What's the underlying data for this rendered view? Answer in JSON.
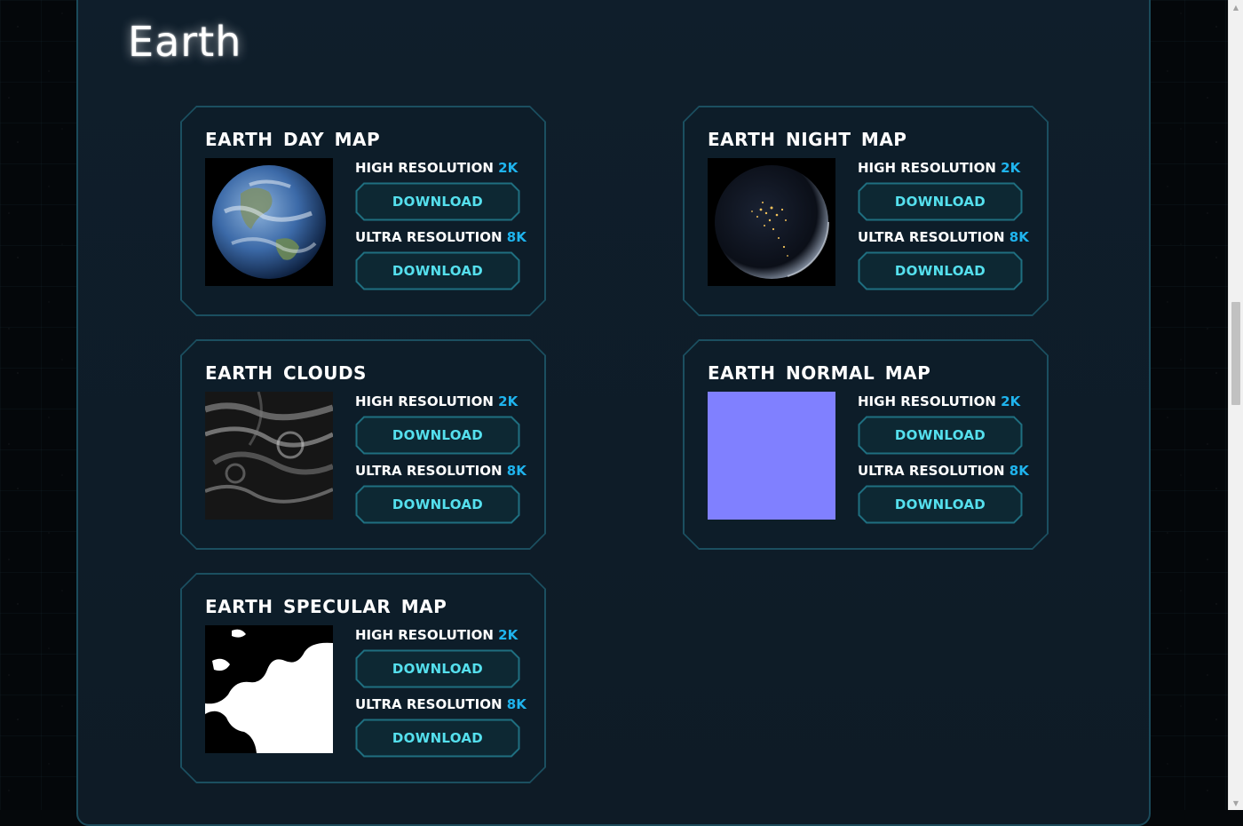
{
  "section": {
    "title": "Earth"
  },
  "cards": [
    {
      "title": "EARTH DAY MAP",
      "thumbnail": "earth-day-globe",
      "high": {
        "label": "HIGH RESOLUTION",
        "value": "2K",
        "button": "DOWNLOAD"
      },
      "ultra": {
        "label": "ULTRA RESOLUTION",
        "value": "8K",
        "button": "DOWNLOAD"
      }
    },
    {
      "title": "EARTH NIGHT MAP",
      "thumbnail": "earth-night-globe",
      "high": {
        "label": "HIGH RESOLUTION",
        "value": "2K",
        "button": "DOWNLOAD"
      },
      "ultra": {
        "label": "ULTRA RESOLUTION",
        "value": "8K",
        "button": "DOWNLOAD"
      }
    },
    {
      "title": "EARTH CLOUDS",
      "thumbnail": "earth-clouds-texture",
      "high": {
        "label": "HIGH RESOLUTION",
        "value": "2K",
        "button": "DOWNLOAD"
      },
      "ultra": {
        "label": "ULTRA RESOLUTION",
        "value": "8K",
        "button": "DOWNLOAD"
      }
    },
    {
      "title": "EARTH NORMAL MAP",
      "thumbnail": "normal-map-swatch",
      "high": {
        "label": "HIGH RESOLUTION",
        "value": "2K",
        "button": "DOWNLOAD"
      },
      "ultra": {
        "label": "ULTRA RESOLUTION",
        "value": "8K",
        "button": "DOWNLOAD"
      }
    },
    {
      "title": "EARTH SPECULAR MAP",
      "thumbnail": "specular-map-texture",
      "high": {
        "label": "HIGH RESOLUTION",
        "value": "2K",
        "button": "DOWNLOAD"
      },
      "ultra": {
        "label": "ULTRA RESOLUTION",
        "value": "8K",
        "button": "DOWNLOAD"
      }
    }
  ],
  "colors": {
    "accent": "#1fb4ee",
    "button_text": "#55e0ee",
    "card_border": "#1b4f60",
    "normal_map": "#8080ff"
  }
}
